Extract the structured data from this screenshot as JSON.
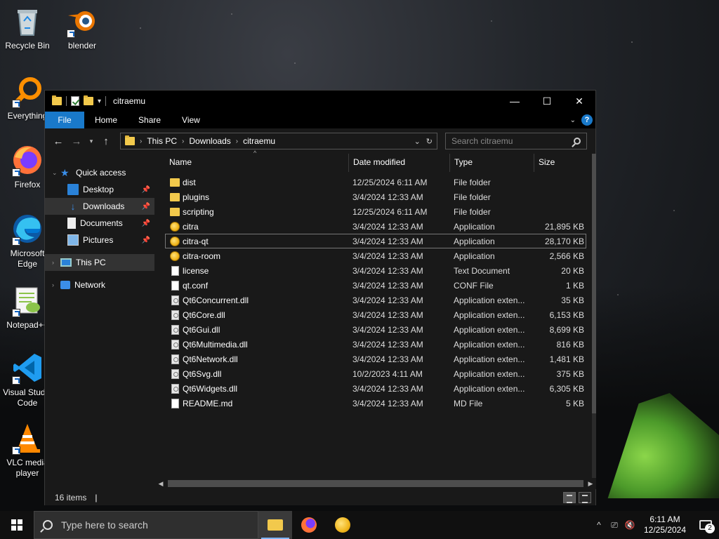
{
  "desktop": {
    "icons": [
      {
        "label": "Recycle Bin",
        "icon": "recycle-bin-icon"
      },
      {
        "label": "blender",
        "icon": "blender-icon"
      },
      {
        "label": "Everything",
        "icon": "everything-search-icon"
      },
      {
        "label": "Firefox",
        "icon": "firefox-icon"
      },
      {
        "label": "Microsoft Edge",
        "icon": "edge-icon"
      },
      {
        "label": "Notepad++",
        "icon": "notepad-plus-plus-icon"
      },
      {
        "label": "Visual Studio Code",
        "icon": "vscode-icon"
      },
      {
        "label": "VLC media player",
        "icon": "vlc-icon"
      }
    ]
  },
  "window": {
    "title": "citraemu",
    "controls": {
      "minimize": "—",
      "maximize": "☐",
      "close": "✕"
    },
    "ribbon_tabs": [
      "File",
      "Home",
      "Share",
      "View"
    ],
    "address": {
      "crumbs": [
        "This PC",
        "Downloads",
        "citraemu"
      ]
    },
    "search": {
      "placeholder": "Search citraemu"
    },
    "nav_pane": {
      "quick_access": "Quick access",
      "items": [
        "Desktop",
        "Downloads",
        "Documents",
        "Pictures"
      ],
      "this_pc": "This PC",
      "network": "Network"
    },
    "columns": {
      "name": "Name",
      "date": "Date modified",
      "type": "Type",
      "size": "Size"
    },
    "files": [
      {
        "name": "dist",
        "date": "12/25/2024 6:11 AM",
        "type": "File folder",
        "size": "",
        "icon": "folder"
      },
      {
        "name": "plugins",
        "date": "3/4/2024 12:33 AM",
        "type": "File folder",
        "size": "",
        "icon": "folder"
      },
      {
        "name": "scripting",
        "date": "12/25/2024 6:11 AM",
        "type": "File folder",
        "size": "",
        "icon": "folder"
      },
      {
        "name": "citra",
        "date": "3/4/2024 12:33 AM",
        "type": "Application",
        "size": "21,895 KB",
        "icon": "app"
      },
      {
        "name": "citra-qt",
        "date": "3/4/2024 12:33 AM",
        "type": "Application",
        "size": "28,170 KB",
        "icon": "app"
      },
      {
        "name": "citra-room",
        "date": "3/4/2024 12:33 AM",
        "type": "Application",
        "size": "2,566 KB",
        "icon": "app"
      },
      {
        "name": "license",
        "date": "3/4/2024 12:33 AM",
        "type": "Text Document",
        "size": "20 KB",
        "icon": "text"
      },
      {
        "name": "qt.conf",
        "date": "3/4/2024 12:33 AM",
        "type": "CONF File",
        "size": "1 KB",
        "icon": "text"
      },
      {
        "name": "Qt6Concurrent.dll",
        "date": "3/4/2024 12:33 AM",
        "type": "Application exten...",
        "size": "35 KB",
        "icon": "dll"
      },
      {
        "name": "Qt6Core.dll",
        "date": "3/4/2024 12:33 AM",
        "type": "Application exten...",
        "size": "6,153 KB",
        "icon": "dll"
      },
      {
        "name": "Qt6Gui.dll",
        "date": "3/4/2024 12:33 AM",
        "type": "Application exten...",
        "size": "8,699 KB",
        "icon": "dll"
      },
      {
        "name": "Qt6Multimedia.dll",
        "date": "3/4/2024 12:33 AM",
        "type": "Application exten...",
        "size": "816 KB",
        "icon": "dll"
      },
      {
        "name": "Qt6Network.dll",
        "date": "3/4/2024 12:33 AM",
        "type": "Application exten...",
        "size": "1,481 KB",
        "icon": "dll"
      },
      {
        "name": "Qt6Svg.dll",
        "date": "10/2/2023 4:11 AM",
        "type": "Application exten...",
        "size": "375 KB",
        "icon": "dll"
      },
      {
        "name": "Qt6Widgets.dll",
        "date": "3/4/2024 12:33 AM",
        "type": "Application exten...",
        "size": "6,305 KB",
        "icon": "dll"
      },
      {
        "name": "README.md",
        "date": "3/4/2024 12:33 AM",
        "type": "MD File",
        "size": "5 KB",
        "icon": "text"
      }
    ],
    "status": {
      "item_count": "16 items"
    }
  },
  "taskbar": {
    "search_placeholder": "Type here to search",
    "time": "6:11 AM",
    "date": "12/25/2024",
    "notification_count": "2"
  },
  "colors": {
    "accent": "#1979ca",
    "window_bg": "#191919",
    "folder": "#f2c94c"
  }
}
